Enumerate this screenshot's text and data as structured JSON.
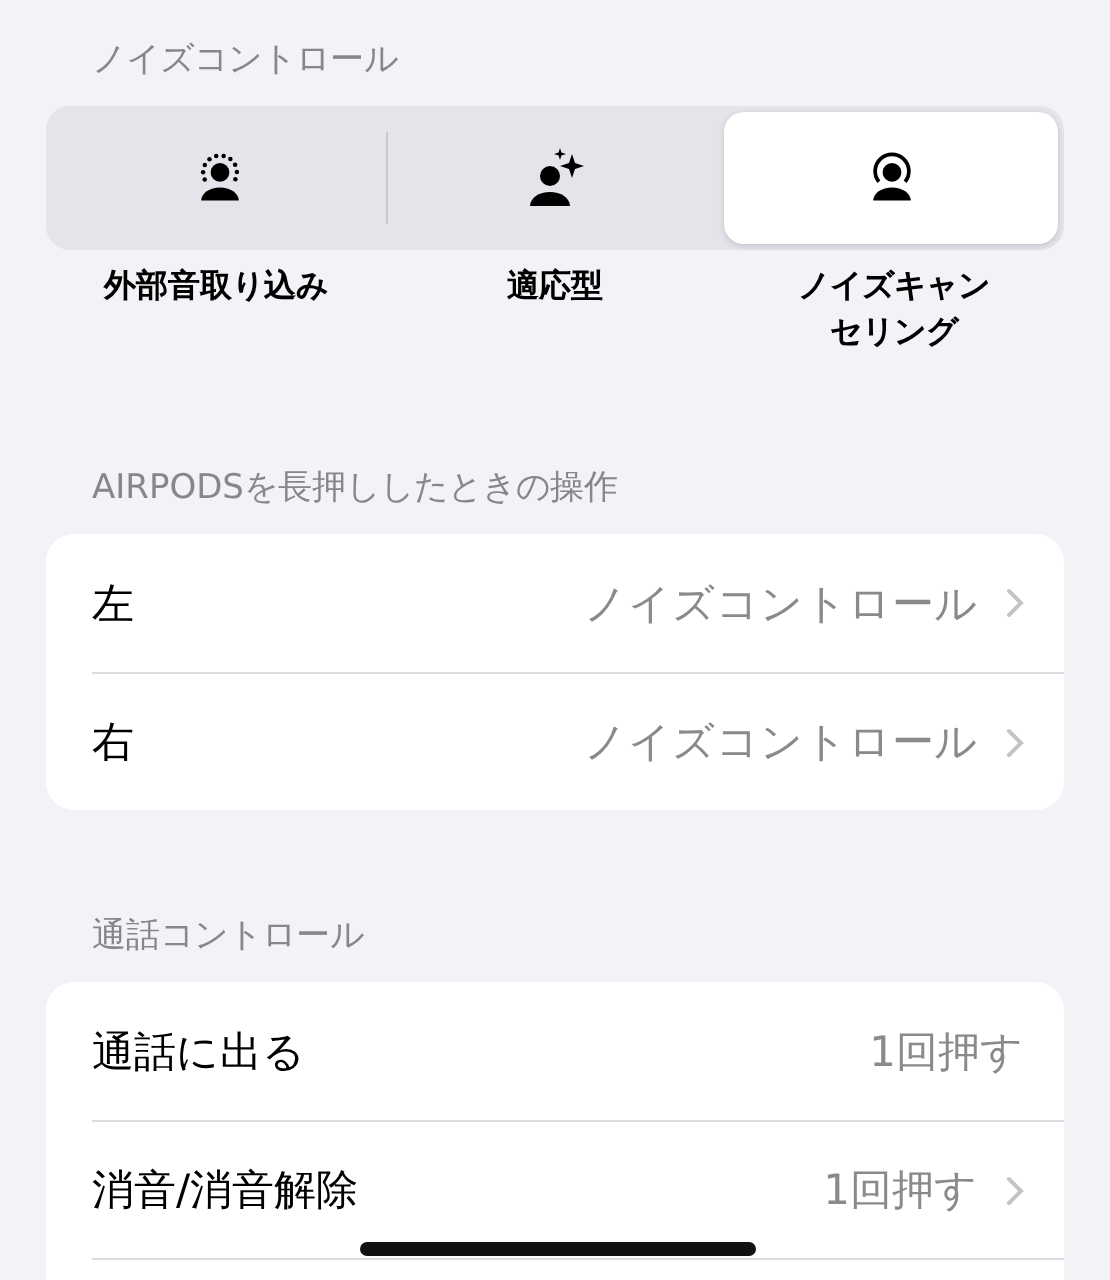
{
  "noise_control": {
    "header": "ノイズコントロール",
    "modes": [
      {
        "kind": "transparency",
        "label": "外部音取り込み",
        "selected": false
      },
      {
        "kind": "adaptive",
        "label": "適応型",
        "selected": false
      },
      {
        "kind": "cancellation",
        "label": "ノイズキャンセリング",
        "selected": true
      }
    ]
  },
  "press_hold": {
    "header": "AIRPODSを長押ししたときの操作",
    "rows": [
      {
        "label": "左",
        "value": "ノイズコントロール",
        "chevron": true
      },
      {
        "label": "右",
        "value": "ノイズコントロール",
        "chevron": true
      }
    ]
  },
  "call_controls": {
    "header": "通話コントロール",
    "rows": [
      {
        "label": "通話に出る",
        "value": "1回押す",
        "chevron": false
      },
      {
        "label": "消音/消音解除",
        "value": "1回押す",
        "chevron": true
      }
    ]
  }
}
